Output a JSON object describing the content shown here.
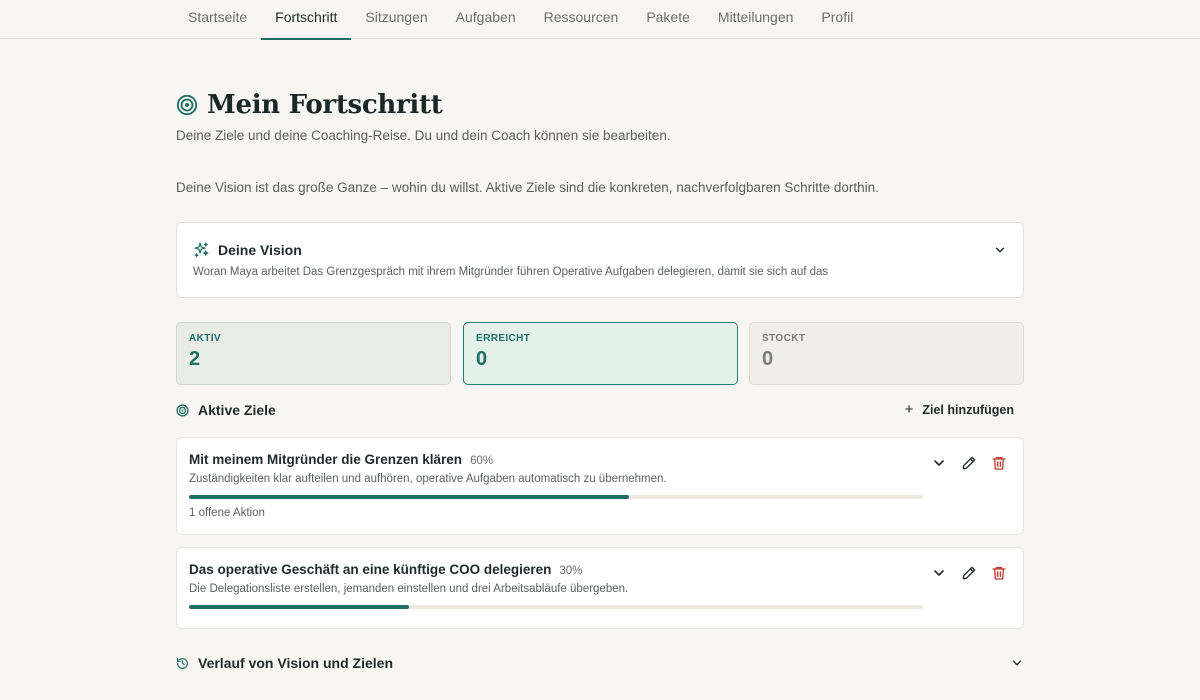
{
  "nav": {
    "tabs": [
      {
        "label": "Startseite"
      },
      {
        "label": "Fortschritt"
      },
      {
        "label": "Sitzungen"
      },
      {
        "label": "Aufgaben"
      },
      {
        "label": "Ressourcen"
      },
      {
        "label": "Pakete"
      },
      {
        "label": "Mitteilungen"
      },
      {
        "label": "Profil"
      }
    ],
    "active_tab": "Fortschritt"
  },
  "page": {
    "title": "Mein Fortschritt",
    "subtitle": "Deine Ziele und deine Coaching-Reise. Du und dein Coach können sie bearbeiten.",
    "intro": "Deine Vision ist das große Ganze – wohin du willst. Aktive Ziele sind die konkreten, nachverfolgbaren Schritte dorthin."
  },
  "vision": {
    "title": "Deine Vision",
    "text": "Woran Maya arbeitet Das Grenzgespräch mit ihrem Mitgründer führen Operative Aufgaben delegieren, damit sie sich auf das",
    "icon": "sparkles-icon"
  },
  "stats": {
    "aktiv": {
      "label": "AKTIV",
      "value": "2"
    },
    "erreicht": {
      "label": "ERREICHT",
      "value": "0"
    },
    "stockt": {
      "label": "STOCKT",
      "value": "0"
    }
  },
  "active_goals": {
    "title": "Aktive Ziele",
    "add_label": "Ziel hinzufügen",
    "goals": [
      {
        "title": "Mit meinem Mitgründer die Grenzen klären",
        "percent_label": "60%",
        "progress": 0.6,
        "description": "Zuständigkeiten klar aufteilen und aufhören, operative Aufgaben automatisch zu übernehmen.",
        "footer": "1 offene Aktion"
      },
      {
        "title": "Das operative Geschäft an eine künftige COO delegieren",
        "percent_label": "30%",
        "progress": 0.3,
        "description": "Die Delegationsliste erstellen, jemanden einstellen und drei Arbeitsabläufe übergeben.",
        "footer": ""
      }
    ]
  },
  "history": {
    "title": "Verlauf von Vision und Zielen"
  },
  "colors": {
    "accent": "#1f6f66",
    "danger": "#c0392b",
    "background": "#f8f6f2"
  }
}
